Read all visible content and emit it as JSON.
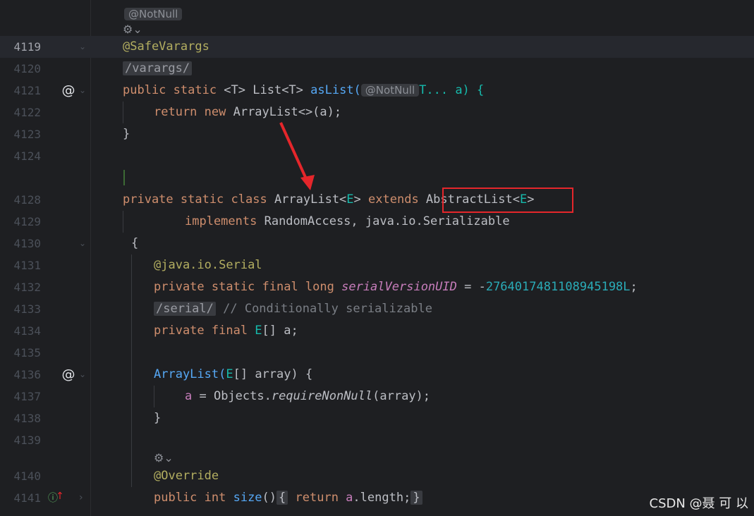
{
  "top_hint": "@NotNull",
  "lines": [
    {
      "ln": "4119",
      "code": "@SafeVarargs"
    },
    {
      "ln": "4120",
      "code": "/varargs/"
    },
    {
      "ln": "4121",
      "code_kw": "public static ",
      "t1": "<T> ",
      "t2": "List<T> ",
      "fn": "asList(",
      "hint": "@NotNull",
      "rest": "T... a) {"
    },
    {
      "ln": "4122",
      "code_kw": "return new ",
      "rest": "ArrayList<>(a);"
    },
    {
      "ln": "4123",
      "code": "}"
    },
    {
      "ln": "4124",
      "code": ""
    },
    {
      "ln": "4128",
      "kw": "private static class ",
      "name": "ArrayList<",
      "typ": "E",
      "close": "> ",
      "ext": "extends ",
      "box": "AbstractList<",
      "boxt": "E",
      "boxc": ">"
    },
    {
      "ln": "4129",
      "kw": "implements ",
      "rest": "RandomAccess, java.io.Serializable"
    },
    {
      "ln": "4130",
      "code": "{"
    },
    {
      "ln": "4131",
      "ann": "@java.io.",
      "ann2": "Serial"
    },
    {
      "ln": "4132",
      "kw": "private static final long ",
      "field": "serialVersionUID",
      "eq": " = -",
      "num": "2764017481108945198L",
      "semi": ";"
    },
    {
      "ln": "4133",
      "tag": "/serial/",
      "cmt": " // Conditionally serializable"
    },
    {
      "ln": "4134",
      "kw": "private final ",
      "typ": "E",
      "rest": "[] a;"
    },
    {
      "ln": "4135",
      "code": ""
    },
    {
      "ln": "4136",
      "fn": "ArrayList(",
      "typ": "E",
      "rest": "[] array) {"
    },
    {
      "ln": "4137",
      "field": "a",
      "rest": " = Objects.",
      "it": "requireNonNull",
      "rest2": "(array);"
    },
    {
      "ln": "4138",
      "code": "}"
    },
    {
      "ln": "4139",
      "code": ""
    },
    {
      "ln": "4140",
      "ann": "@Override"
    },
    {
      "ln": "4141",
      "kw": "public int ",
      "fn": "size",
      "paren": "()",
      "brace1": "{",
      "kw2": " return ",
      "field": "a",
      "rest": ".length;",
      "brace2": "}"
    }
  ],
  "watermark": "CSDN @聂 可 以",
  "colors": {
    "keyword": "#cf8e6d",
    "annotation": "#b3ae60",
    "function": "#56a8f5",
    "type": "#16baac",
    "number": "#2aacb8",
    "field": "#c77dbb",
    "comment": "#7a7e85",
    "highlight_box": "#e5262b"
  }
}
